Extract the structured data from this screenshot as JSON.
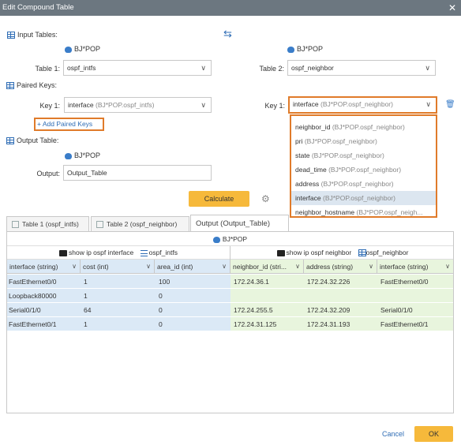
{
  "window": {
    "title": "Edit Compound Table",
    "close": "✕"
  },
  "swap_icon": "⇆",
  "input_tables": {
    "label": "Input Tables:",
    "table1": {
      "device": "BJ*POP",
      "label": "Table 1:",
      "value": "ospf_intfs"
    },
    "table2": {
      "device": "BJ*POP",
      "label": "Table 2:",
      "value": "ospf_neighbor"
    }
  },
  "paired_keys": {
    "label": "Paired Keys:",
    "key1_left": {
      "label": "Key 1:",
      "field": "interface",
      "source": "(BJ*POP.ospf_intfs)"
    },
    "key1_right": {
      "label": "Key 1:",
      "field": "interface",
      "source": "(BJ*POP.ospf_neighbor)"
    },
    "add_link": "+ Add Paired Keys",
    "dropdown_options": [
      {
        "field": "neighbor_id",
        "source": "(BJ*POP.ospf_neighbor)",
        "selected": false
      },
      {
        "field": "pri",
        "source": "(BJ*POP.ospf_neighbor)",
        "selected": false
      },
      {
        "field": "state",
        "source": "(BJ*POP.ospf_neighbor)",
        "selected": false
      },
      {
        "field": "dead_time",
        "source": "(BJ*POP.ospf_neighbor)",
        "selected": false
      },
      {
        "field": "address",
        "source": "(BJ*POP.ospf_neighbor)",
        "selected": false
      },
      {
        "field": "interface",
        "source": "(BJ*POP.ospf_neighbor)",
        "selected": true
      },
      {
        "field": "neighbor_hostname",
        "source": "(BJ*POP.ospf_neigh...",
        "selected": false
      }
    ]
  },
  "output_table": {
    "label": "Output Table:",
    "device": "BJ*POP",
    "output_label": "Output:",
    "value": "Output_Table"
  },
  "buttons": {
    "calculate": "Calculate",
    "cancel": "Cancel",
    "ok": "OK"
  },
  "tabs": [
    {
      "label": "Table 1 (ospf_intfs)",
      "active": false
    },
    {
      "label": "Table 2 (ospf_neighbor)",
      "active": false
    },
    {
      "label": "Output (Output_Table)",
      "active": true
    }
  ],
  "grid": {
    "device": "BJ*POP",
    "group_left": {
      "command": "show ip ospf interface",
      "table": "ospf_intfs"
    },
    "group_right": {
      "command": "show ip ospf neighbor",
      "table": "ospf_neighbor"
    },
    "columns": [
      "interface (string)",
      "cost (int)",
      "area_id (int)",
      "neighbor_id (stri...",
      "address (string)",
      "interface (string)"
    ],
    "rows": [
      [
        "FastEthernet0/0",
        "1",
        "100",
        "172.24.36.1",
        "172.24.32.226",
        "FastEthernet0/0"
      ],
      [
        "Loopback80000",
        "1",
        "0",
        "",
        "",
        ""
      ],
      [
        "Serial0/1/0",
        "64",
        "0",
        "172.24.255.5",
        "172.24.32.209",
        "Serial0/1/0"
      ],
      [
        "FastEthernet0/1",
        "1",
        "0",
        "172.24.31.125",
        "172.24.31.193",
        "FastEthernet0/1"
      ]
    ]
  }
}
